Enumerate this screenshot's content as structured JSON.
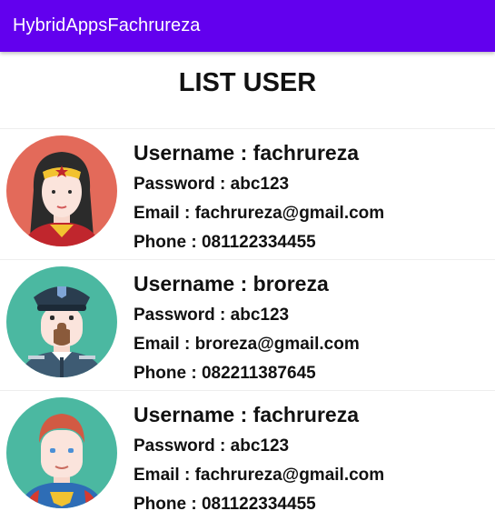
{
  "appbar": {
    "title": "HybridAppsFachrureza",
    "color": "#6200ee"
  },
  "page": {
    "title": "LIST USER"
  },
  "users": [
    {
      "avatar_icon": "wonder-woman-avatar-icon",
      "username": "Username : fachrureza",
      "password": "Password : abc123",
      "email": "Email : fachrureza@gmail.com",
      "phone": "Phone : 081122334455"
    },
    {
      "avatar_icon": "police-officer-avatar-icon",
      "username": "Username : broreza",
      "password": "Password : abc123",
      "email": "Email : broreza@gmail.com",
      "phone": "Phone : 082211387645"
    },
    {
      "avatar_icon": "superman-avatar-icon",
      "username": "Username : fachrureza",
      "password": "Password : abc123",
      "email": "Email : fachrureza@gmail.com",
      "phone": "Phone : 081122334455"
    }
  ]
}
